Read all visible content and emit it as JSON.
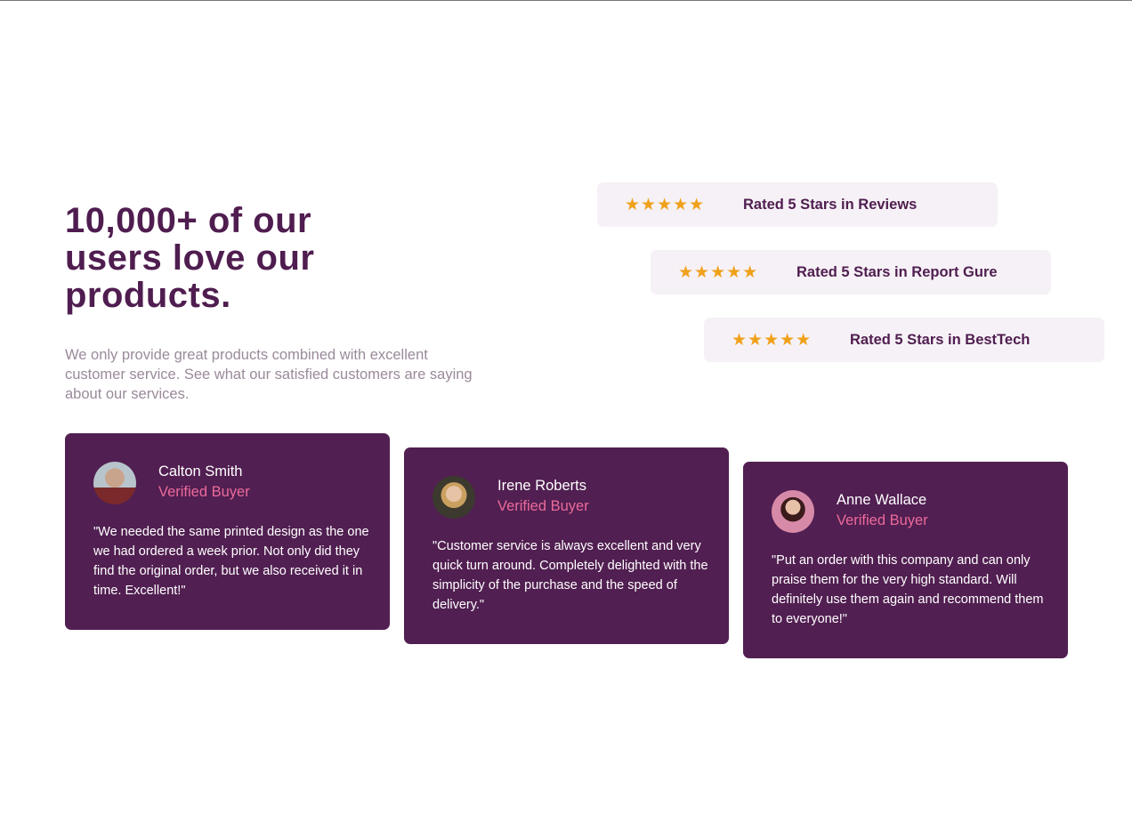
{
  "hero": {
    "title": "10,000+ of our users love our products.",
    "description": "We only provide great products combined with excellent customer service. See what our satisfied customers are saying about our services."
  },
  "ratings": [
    {
      "stars": "★★★★★",
      "rating": 5,
      "label": "Rated 5 Stars in Reviews"
    },
    {
      "stars": "★★★★★",
      "rating": 5,
      "label": "Rated 5 Stars in Report Gure"
    },
    {
      "stars": "★★★★★",
      "rating": 5,
      "label": "Rated 5 Stars in BestTech"
    }
  ],
  "testimonials": [
    {
      "name": "Calton Smith",
      "role": "Verified Buyer",
      "quote": "\"We needed the same printed design as the one we had ordered a week prior. Not only did they find the original order, but we also received it in time. Excellent!\""
    },
    {
      "name": "Irene Roberts",
      "role": "Verified Buyer",
      "quote": "\"Customer service is always excellent and very quick turn around. Completely delighted with the simplicity of the purchase and the speed of delivery.\""
    },
    {
      "name": "Anne Wallace",
      "role": "Verified Buyer",
      "quote": "\"Put an order with this company and can only praise them for the very high standard. Will definitely use them again and recommend them to everyone!\""
    }
  ],
  "colors": {
    "primary": "#4f1d4f",
    "accent": "#ec6a9b",
    "star": "#f0a11b",
    "rating_bg": "#f6f1f6"
  }
}
